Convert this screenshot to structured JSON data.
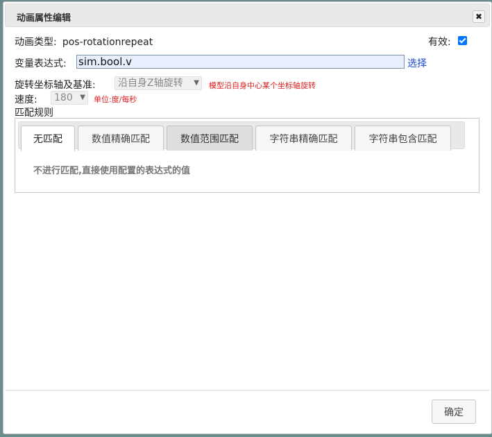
{
  "dialog": {
    "title": "动画属性编辑",
    "close_glyph": "✖"
  },
  "anim_type": {
    "label": "动画类型:",
    "value": "pos-rotationrepeat"
  },
  "enabled": {
    "label": "有效:",
    "checked": true
  },
  "expr": {
    "label": "变量表达式:",
    "value": "sim.bool.v",
    "select_link": "选择"
  },
  "axis": {
    "label": "旋转坐标轴及基准:",
    "selected": "沿自身Z轴旋转",
    "hint": "模型沿自身中心某个坐标轴旋转"
  },
  "speed": {
    "label": "速度:",
    "selected": "180",
    "hint": "单位:度/每秒"
  },
  "match_rules": {
    "label": "匹配规则",
    "tabs": [
      {
        "label": "无匹配"
      },
      {
        "label": "数值精确匹配"
      },
      {
        "label": "数值范围匹配"
      },
      {
        "label": "字符串精确匹配"
      },
      {
        "label": "字符串包含匹配"
      }
    ],
    "active_tab": "无匹配",
    "panel_text": "不进行匹配,直接使用配置的表达式的值"
  },
  "footer": {
    "ok_label": "确定"
  },
  "colors": {
    "accent": "#0075ff",
    "hint": "#e01e1e",
    "link": "#1a47d6"
  }
}
